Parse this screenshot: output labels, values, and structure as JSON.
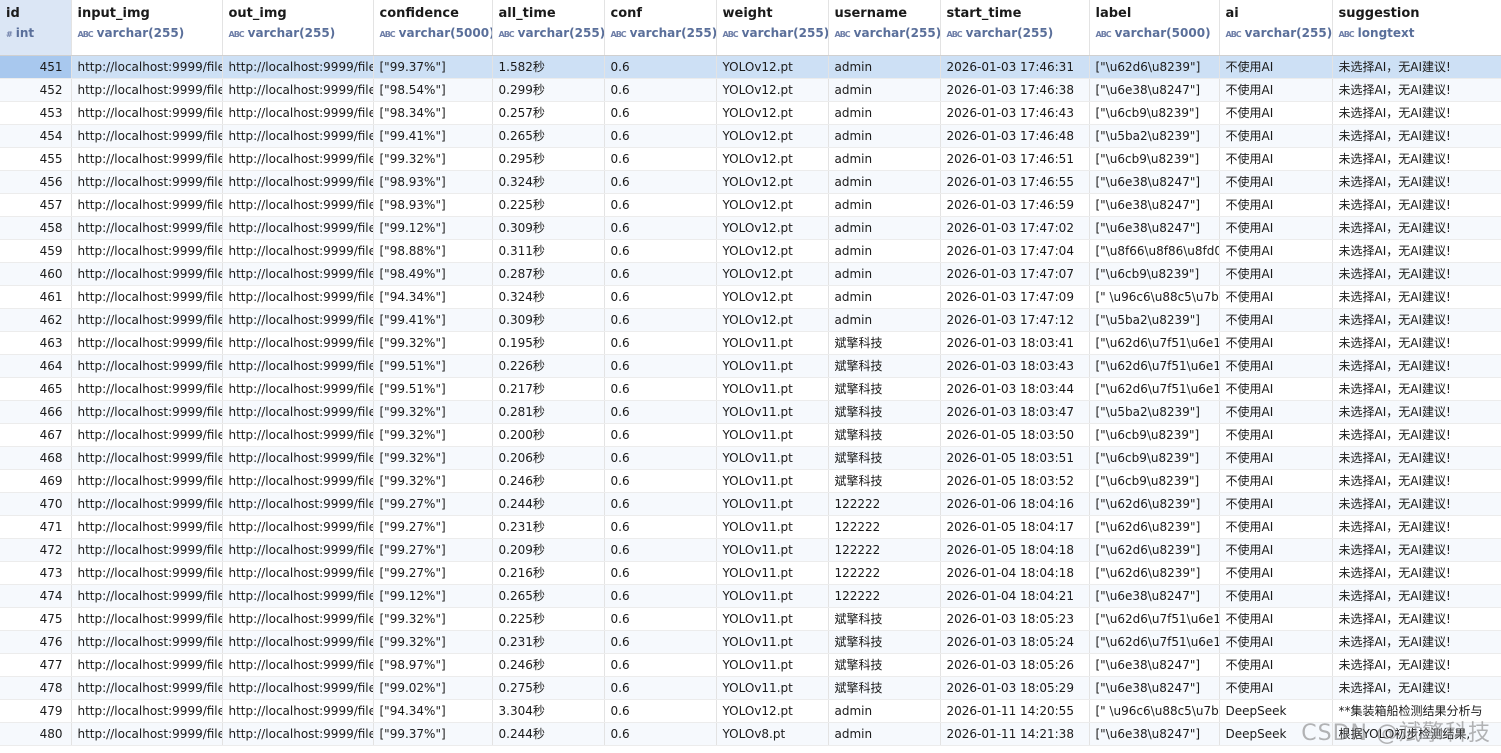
{
  "columns": [
    {
      "name": "id",
      "type": "int",
      "icon": "#"
    },
    {
      "name": "input_img",
      "type": "varchar(255)",
      "icon": "ABC"
    },
    {
      "name": "out_img",
      "type": "varchar(255)",
      "icon": "ABC"
    },
    {
      "name": "confidence",
      "type": "varchar(5000)",
      "icon": "ABC"
    },
    {
      "name": "all_time",
      "type": "varchar(255)",
      "icon": "ABC"
    },
    {
      "name": "conf",
      "type": "varchar(255)",
      "icon": "ABC"
    },
    {
      "name": "weight",
      "type": "varchar(255)",
      "icon": "ABC"
    },
    {
      "name": "username",
      "type": "varchar(255)",
      "icon": "ABC"
    },
    {
      "name": "start_time",
      "type": "varchar(255)",
      "icon": "ABC"
    },
    {
      "name": "label",
      "type": "varchar(5000)",
      "icon": "ABC"
    },
    {
      "name": "ai",
      "type": "varchar(255)",
      "icon": "ABC"
    },
    {
      "name": "suggestion",
      "type": "longtext",
      "icon": "ABC"
    }
  ],
  "selected_row_id": "451",
  "rows": [
    [
      "451",
      "http://localhost:9999/file",
      "http://localhost:9999/file",
      "[\"99.37%\"]",
      "1.582秒",
      "0.6",
      "YOLOv12.pt",
      "admin",
      "2026-01-03 17:46:31",
      "[\"\\u62d6\\u8239\"]",
      "不使用AI",
      "未选择AI，无AI建议!"
    ],
    [
      "452",
      "http://localhost:9999/file",
      "http://localhost:9999/file",
      "[\"98.54%\"]",
      "0.299秒",
      "0.6",
      "YOLOv12.pt",
      "admin",
      "2026-01-03 17:46:38",
      "[\"\\u6e38\\u8247\"]",
      "不使用AI",
      "未选择AI，无AI建议!"
    ],
    [
      "453",
      "http://localhost:9999/file",
      "http://localhost:9999/file",
      "[\"98.34%\"]",
      "0.257秒",
      "0.6",
      "YOLOv12.pt",
      "admin",
      "2026-01-03 17:46:43",
      "[\"\\u6cb9\\u8239\"]",
      "不使用AI",
      "未选择AI，无AI建议!"
    ],
    [
      "454",
      "http://localhost:9999/file",
      "http://localhost:9999/file",
      "[\"99.41%\"]",
      "0.265秒",
      "0.6",
      "YOLOv12.pt",
      "admin",
      "2026-01-03 17:46:48",
      "[\"\\u5ba2\\u8239\"]",
      "不使用AI",
      "未选择AI，无AI建议!"
    ],
    [
      "455",
      "http://localhost:9999/file",
      "http://localhost:9999/file",
      "[\"99.32%\"]",
      "0.295秒",
      "0.6",
      "YOLOv12.pt",
      "admin",
      "2026-01-03 17:46:51",
      "[\"\\u6cb9\\u8239\"]",
      "不使用AI",
      "未选择AI，无AI建议!"
    ],
    [
      "456",
      "http://localhost:9999/file",
      "http://localhost:9999/file",
      "[\"98.93%\"]",
      "0.324秒",
      "0.6",
      "YOLOv12.pt",
      "admin",
      "2026-01-03 17:46:55",
      "[\"\\u6e38\\u8247\"]",
      "不使用AI",
      "未选择AI，无AI建议!"
    ],
    [
      "457",
      "http://localhost:9999/file",
      "http://localhost:9999/file",
      "[\"98.93%\"]",
      "0.225秒",
      "0.6",
      "YOLOv12.pt",
      "admin",
      "2026-01-03 17:46:59",
      "[\"\\u6e38\\u8247\"]",
      "不使用AI",
      "未选择AI，无AI建议!"
    ],
    [
      "458",
      "http://localhost:9999/file",
      "http://localhost:9999/file",
      "[\"99.12%\"]",
      "0.309秒",
      "0.6",
      "YOLOv12.pt",
      "admin",
      "2026-01-03 17:47:02",
      "[\"\\u6e38\\u8247\"]",
      "不使用AI",
      "未选择AI，无AI建议!"
    ],
    [
      "459",
      "http://localhost:9999/file",
      "http://localhost:9999/file",
      "[\"98.88%\"]",
      "0.311秒",
      "0.6",
      "YOLOv12.pt",
      "admin",
      "2026-01-03 17:47:04",
      "[\"\\u8f66\\u8f86\\u8fd0",
      "不使用AI",
      "未选择AI，无AI建议!"
    ],
    [
      "460",
      "http://localhost:9999/file",
      "http://localhost:9999/file",
      "[\"98.49%\"]",
      "0.287秒",
      "0.6",
      "YOLOv12.pt",
      "admin",
      "2026-01-03 17:47:07",
      "[\"\\u6cb9\\u8239\"]",
      "不使用AI",
      "未选择AI，无AI建议!"
    ],
    [
      "461",
      "http://localhost:9999/file",
      "http://localhost:9999/file",
      "[\"94.34%\"]",
      "0.324秒",
      "0.6",
      "YOLOv12.pt",
      "admin",
      "2026-01-03 17:47:09",
      "[\" \\u96c6\\u88c5\\u7b",
      "不使用AI",
      "未选择AI，无AI建议!"
    ],
    [
      "462",
      "http://localhost:9999/file",
      "http://localhost:9999/file",
      "[\"99.41%\"]",
      "0.309秒",
      "0.6",
      "YOLOv12.pt",
      "admin",
      "2026-01-03 17:47:12",
      "[\"\\u5ba2\\u8239\"]",
      "不使用AI",
      "未选择AI，无AI建议!"
    ],
    [
      "463",
      "http://localhost:9999/file",
      "http://localhost:9999/file",
      "[\"99.32%\"]",
      "0.195秒",
      "0.6",
      "YOLOv11.pt",
      "斌擎科技",
      "2026-01-03 18:03:41",
      "[\"\\u62d6\\u7f51\\u6e1",
      "不使用AI",
      "未选择AI，无AI建议!"
    ],
    [
      "464",
      "http://localhost:9999/file",
      "http://localhost:9999/file",
      "[\"99.51%\"]",
      "0.226秒",
      "0.6",
      "YOLOv11.pt",
      "斌擎科技",
      "2026-01-03 18:03:43",
      "[\"\\u62d6\\u7f51\\u6e1",
      "不使用AI",
      "未选择AI，无AI建议!"
    ],
    [
      "465",
      "http://localhost:9999/file",
      "http://localhost:9999/file",
      "[\"99.51%\"]",
      "0.217秒",
      "0.6",
      "YOLOv11.pt",
      "斌擎科技",
      "2026-01-03 18:03:44",
      "[\"\\u62d6\\u7f51\\u6e1",
      "不使用AI",
      "未选择AI，无AI建议!"
    ],
    [
      "466",
      "http://localhost:9999/file",
      "http://localhost:9999/file",
      "[\"99.32%\"]",
      "0.281秒",
      "0.6",
      "YOLOv11.pt",
      "斌擎科技",
      "2026-01-03 18:03:47",
      "[\"\\u5ba2\\u8239\"]",
      "不使用AI",
      "未选择AI，无AI建议!"
    ],
    [
      "467",
      "http://localhost:9999/file",
      "http://localhost:9999/file",
      "[\"99.32%\"]",
      "0.200秒",
      "0.6",
      "YOLOv11.pt",
      "斌擎科技",
      "2026-01-05 18:03:50",
      "[\"\\u6cb9\\u8239\"]",
      "不使用AI",
      "未选择AI，无AI建议!"
    ],
    [
      "468",
      "http://localhost:9999/file",
      "http://localhost:9999/file",
      "[\"99.32%\"]",
      "0.206秒",
      "0.6",
      "YOLOv11.pt",
      "斌擎科技",
      "2026-01-05 18:03:51",
      "[\"\\u6cb9\\u8239\"]",
      "不使用AI",
      "未选择AI，无AI建议!"
    ],
    [
      "469",
      "http://localhost:9999/file",
      "http://localhost:9999/file",
      "[\"99.32%\"]",
      "0.246秒",
      "0.6",
      "YOLOv11.pt",
      "斌擎科技",
      "2026-01-05 18:03:52",
      "[\"\\u6cb9\\u8239\"]",
      "不使用AI",
      "未选择AI，无AI建议!"
    ],
    [
      "470",
      "http://localhost:9999/file",
      "http://localhost:9999/file",
      "[\"99.27%\"]",
      "0.244秒",
      "0.6",
      "YOLOv11.pt",
      "122222",
      "2026-01-06 18:04:16",
      "[\"\\u62d6\\u8239\"]",
      "不使用AI",
      "未选择AI，无AI建议!"
    ],
    [
      "471",
      "http://localhost:9999/file",
      "http://localhost:9999/file",
      "[\"99.27%\"]",
      "0.231秒",
      "0.6",
      "YOLOv11.pt",
      "122222",
      "2026-01-05 18:04:17",
      "[\"\\u62d6\\u8239\"]",
      "不使用AI",
      "未选择AI，无AI建议!"
    ],
    [
      "472",
      "http://localhost:9999/file",
      "http://localhost:9999/file",
      "[\"99.27%\"]",
      "0.209秒",
      "0.6",
      "YOLOv11.pt",
      "122222",
      "2026-01-05 18:04:18",
      "[\"\\u62d6\\u8239\"]",
      "不使用AI",
      "未选择AI，无AI建议!"
    ],
    [
      "473",
      "http://localhost:9999/file",
      "http://localhost:9999/file",
      "[\"99.27%\"]",
      "0.216秒",
      "0.6",
      "YOLOv11.pt",
      "122222",
      "2026-01-04 18:04:18",
      "[\"\\u62d6\\u8239\"]",
      "不使用AI",
      "未选择AI，无AI建议!"
    ],
    [
      "474",
      "http://localhost:9999/file",
      "http://localhost:9999/file",
      "[\"99.12%\"]",
      "0.265秒",
      "0.6",
      "YOLOv11.pt",
      "122222",
      "2026-01-04 18:04:21",
      "[\"\\u6e38\\u8247\"]",
      "不使用AI",
      "未选择AI，无AI建议!"
    ],
    [
      "475",
      "http://localhost:9999/file",
      "http://localhost:9999/file",
      "[\"99.32%\"]",
      "0.225秒",
      "0.6",
      "YOLOv11.pt",
      "斌擎科技",
      "2026-01-03 18:05:23",
      "[\"\\u62d6\\u7f51\\u6e1",
      "不使用AI",
      "未选择AI，无AI建议!"
    ],
    [
      "476",
      "http://localhost:9999/file",
      "http://localhost:9999/file",
      "[\"99.32%\"]",
      "0.231秒",
      "0.6",
      "YOLOv11.pt",
      "斌擎科技",
      "2026-01-03 18:05:24",
      "[\"\\u62d6\\u7f51\\u6e1",
      "不使用AI",
      "未选择AI，无AI建议!"
    ],
    [
      "477",
      "http://localhost:9999/file",
      "http://localhost:9999/file",
      "[\"98.97%\"]",
      "0.246秒",
      "0.6",
      "YOLOv11.pt",
      "斌擎科技",
      "2026-01-03 18:05:26",
      "[\"\\u6e38\\u8247\"]",
      "不使用AI",
      "未选择AI，无AI建议!"
    ],
    [
      "478",
      "http://localhost:9999/file",
      "http://localhost:9999/file",
      "[\"99.02%\"]",
      "0.275秒",
      "0.6",
      "YOLOv11.pt",
      "斌擎科技",
      "2026-01-03 18:05:29",
      "[\"\\u6e38\\u8247\"]",
      "不使用AI",
      "未选择AI，无AI建议!"
    ],
    [
      "479",
      "http://localhost:9999/file",
      "http://localhost:9999/file",
      "[\"94.34%\"]",
      "3.304秒",
      "0.6",
      "YOLOv12.pt",
      "admin",
      "2026-01-11 14:20:55",
      "[\" \\u96c6\\u88c5\\u7b",
      "DeepSeek",
      "**集装箱船检测结果分析与"
    ],
    [
      "480",
      "http://localhost:9999/file",
      "http://localhost:9999/file",
      "[\"99.37%\"]",
      "0.244秒",
      "0.6",
      "YOLOv8.pt",
      "admin",
      "2026-01-11 14:21:38",
      "[\"\\u6e38\\u8247\"]",
      "DeepSeek",
      "根据YOLO初步检测结果,"
    ]
  ],
  "watermark": "CSDN @斌擎科技"
}
